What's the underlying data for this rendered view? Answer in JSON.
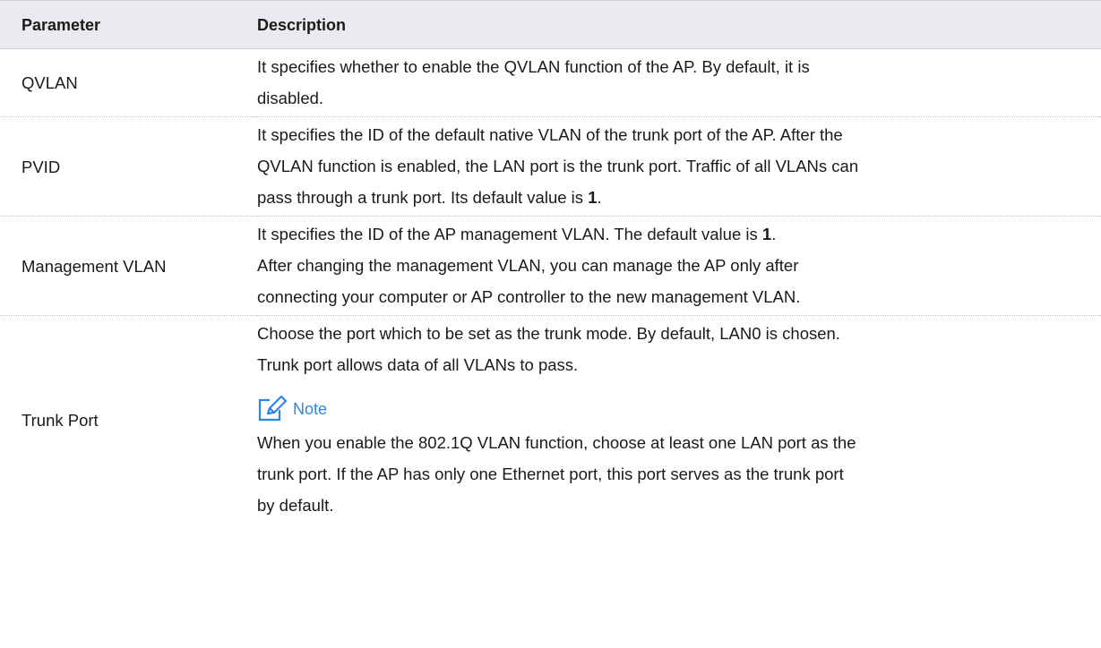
{
  "table": {
    "headers": {
      "parameter": "Parameter",
      "description": "Description"
    },
    "rows": [
      {
        "parameter": "QVLAN",
        "lines": [
          "It specifies whether to enable the QVLAN function of the AP. By default, it is",
          "disabled."
        ]
      },
      {
        "parameter": "PVID",
        "lines": [
          "It specifies the ID of the default native VLAN of the trunk port of the AP. After the",
          "QVLAN function is enabled, the LAN port is the trunk port. Traffic of all VLANs can",
          "pass through a trunk port. Its default value is ",
          "1",
          "."
        ]
      },
      {
        "parameter": "Management VLAN",
        "lines": [
          "It specifies the ID of the AP management VLAN. The default value is ",
          "1",
          ".",
          "After changing the management VLAN, you can manage the AP only after",
          "connecting your computer or AP controller to the new management VLAN."
        ]
      },
      {
        "parameter": "Trunk Port",
        "lines": [
          "Choose the port which to be set as the trunk mode. By default, LAN0 is chosen.",
          "Trunk port allows data of all VLANs to pass."
        ],
        "note": {
          "label": "Note",
          "icon": "note-edit-icon",
          "lines": [
            "When you enable the 802.1Q VLAN function, choose at least one LAN port as the",
            "trunk port. If the AP has only one Ethernet port, this port serves as the trunk port",
            "by default."
          ]
        }
      }
    ]
  },
  "colors": {
    "header_bg": "#e9ebee",
    "note_accent": "#2e86de"
  }
}
